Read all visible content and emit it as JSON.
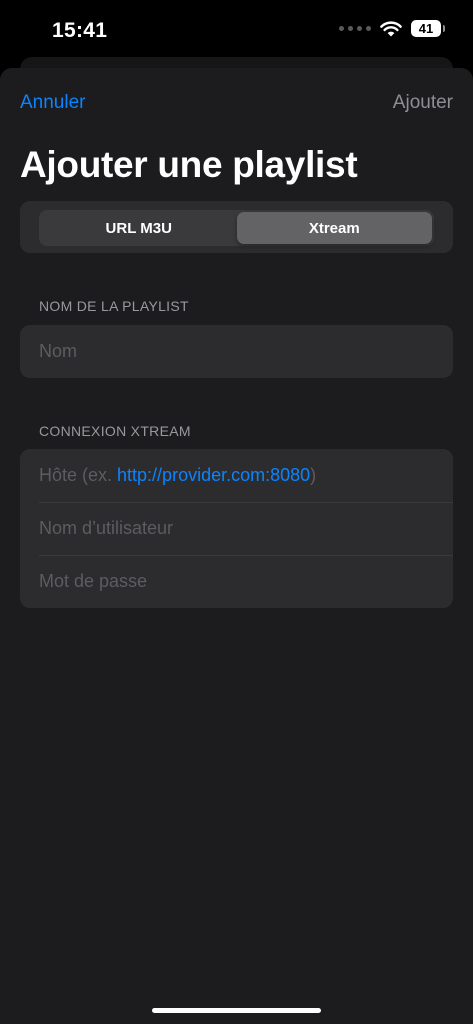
{
  "status": {
    "time": "15:41",
    "battery": "41"
  },
  "nav": {
    "cancel_label": "Annuler",
    "add_label": "Ajouter"
  },
  "page": {
    "title": "Ajouter une playlist"
  },
  "segmented": {
    "options": [
      "URL M3U",
      "Xtream"
    ],
    "selected": "Xtream"
  },
  "playlist_name": {
    "header": "NOM DE LA PLAYLIST",
    "placeholder": "Nom"
  },
  "xtream": {
    "header": "CONNEXION XTREAM",
    "host_placeholder_prefix": "Hôte (ex. ",
    "host_placeholder_link": "http://provider.com:8080",
    "host_placeholder_suffix": ")",
    "username_placeholder": "Nom d’utilisateur",
    "password_placeholder": "Mot de passe"
  },
  "icons": [
    "signal-dots-icon",
    "wifi-icon",
    "battery-icon"
  ],
  "colors": {
    "accent": "#0a84ff",
    "sheet_background": "#1c1c1e",
    "group_background": "#2c2c2e",
    "placeholder": "#5c5c61",
    "disabled": "#8e8e93"
  }
}
